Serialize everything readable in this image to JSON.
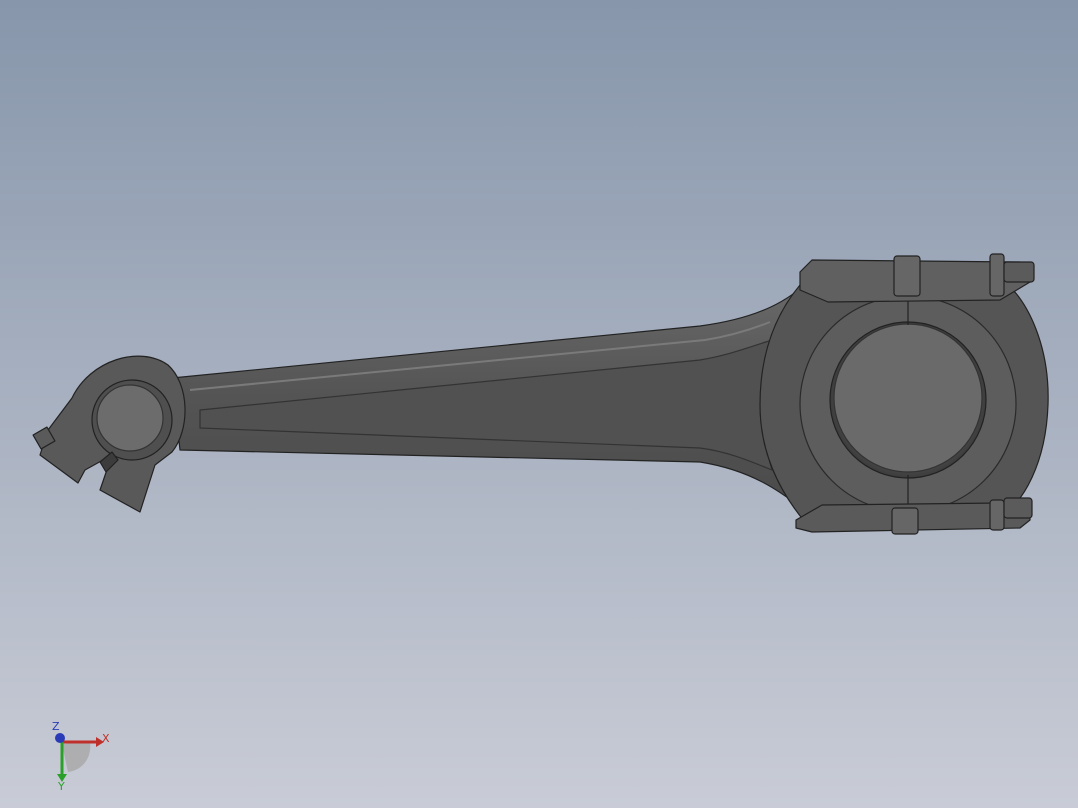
{
  "viewport": {
    "background_top": "#8796ab",
    "background_bottom": "#c9ccd6"
  },
  "model": {
    "body_color": "#585858",
    "edge_color": "#222222",
    "highlight_color": "#7a7a7a"
  },
  "triad": {
    "x_label": "X",
    "y_label": "Y",
    "z_label": "Z",
    "x_color": "#c0302b",
    "y_color": "#2aa02a",
    "z_color": "#2b3bb8"
  }
}
